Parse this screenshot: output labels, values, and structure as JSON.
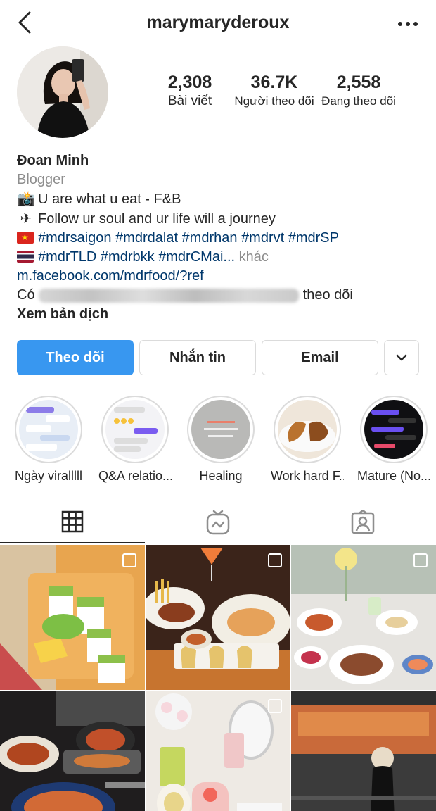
{
  "header": {
    "username": "marymaryderoux",
    "back_icon": "chevron-left-icon",
    "more_icon": "more-dots-icon"
  },
  "profile": {
    "stats": [
      {
        "value": "2,308",
        "label": "Bài viết"
      },
      {
        "value": "36.7K",
        "label": "Người theo dõi"
      },
      {
        "value": "2,558",
        "label": "Đang theo dõi"
      }
    ],
    "name": "Đoan Minh",
    "category": "Blogger",
    "bio_line1": "U are what u eat - F&B",
    "bio_line2": "Follow ur soul and ur life will a journey",
    "hashtags_line1": "#mdrsaigon #mdrdalat #mdrhan #mdrvt #mdrSP",
    "hashtags_line2": "#mdrTLD #mdrbkk #mdrCMai...",
    "more_label": "khác",
    "link": "m.facebook.com/mdrfood/?ref",
    "followed_by_prefix": "Có",
    "followed_by_suffix": "theo dõi",
    "translate_label": "Xem bản dịch"
  },
  "actions": {
    "follow": "Theo dõi",
    "message": "Nhắn tin",
    "email": "Email"
  },
  "highlights": [
    {
      "label": "Ngày viralllll"
    },
    {
      "label": "Q&A relatio..."
    },
    {
      "label": "Healing"
    },
    {
      "label": "Work hard F..."
    },
    {
      "label": "Mature (No..."
    }
  ],
  "tabs": [
    "grid-icon",
    "igtv-icon",
    "tagged-icon"
  ],
  "colors": {
    "accent": "#3897f0",
    "link": "#00376b",
    "muted": "#8e8e8e",
    "border": "#dbdbdb"
  }
}
